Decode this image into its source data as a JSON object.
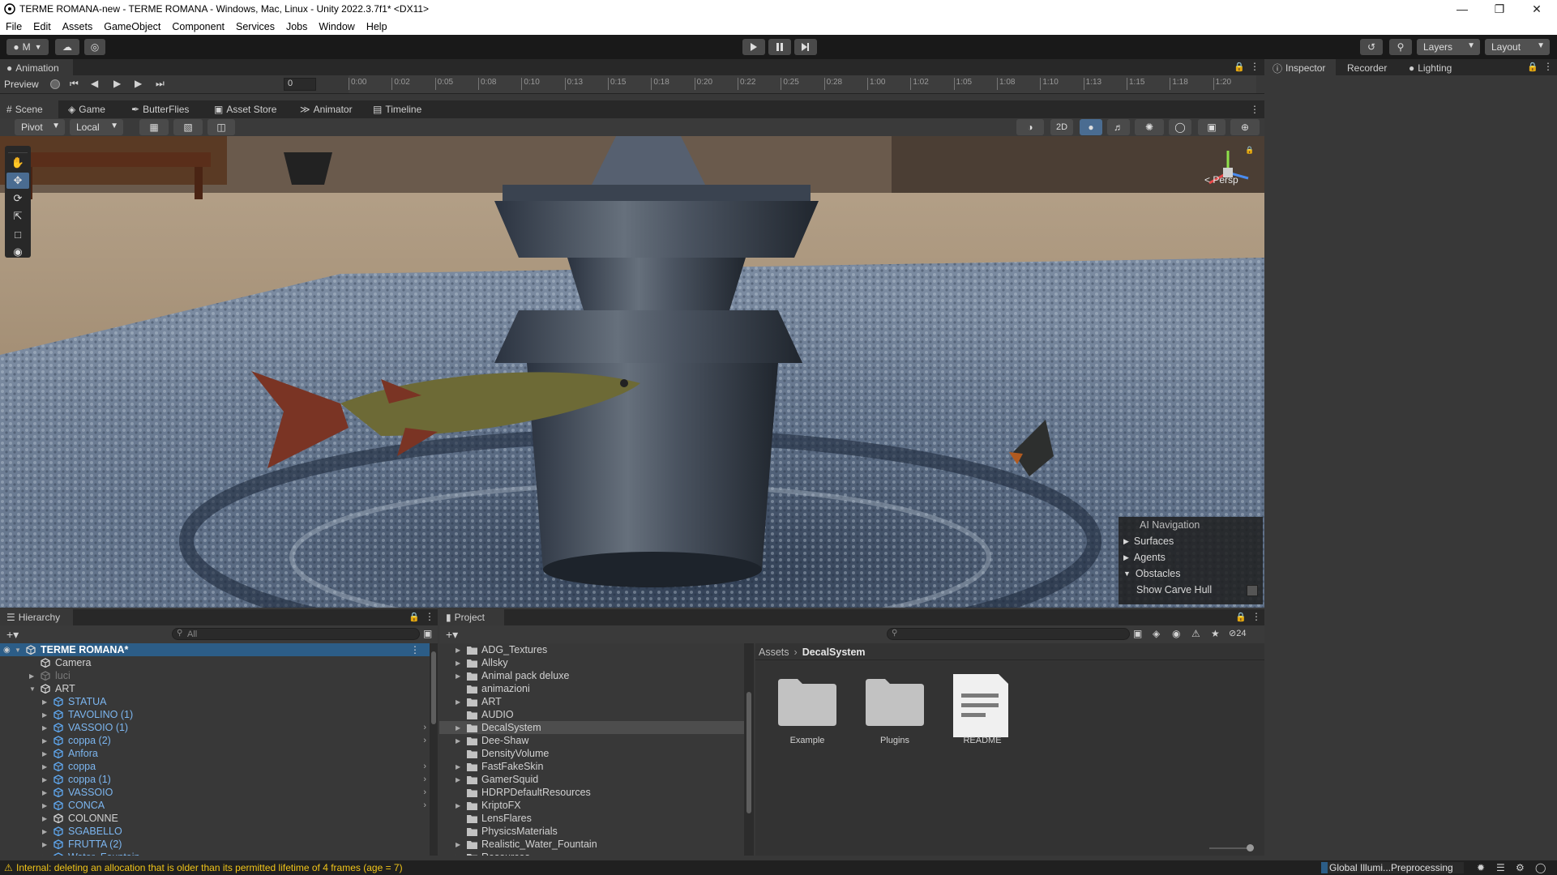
{
  "window": {
    "title": "TERME ROMANA-new - TERME ROMANA - Windows, Mac, Linux - Unity 2022.3.7f1* <DX11>"
  },
  "menu": [
    "File",
    "Edit",
    "Assets",
    "GameObject",
    "Component",
    "Services",
    "Jobs",
    "Window",
    "Help"
  ],
  "toolbar": {
    "account_label": "M",
    "layers_label": "Layers",
    "layout_label": "Layout"
  },
  "animation": {
    "tab_label": "Animation",
    "preview_label": "Preview",
    "frame_value": "0",
    "timeline_ticks": [
      "0:00",
      "0:02",
      "0:05",
      "0:08",
      "0:10",
      "0:13",
      "0:15",
      "0:18",
      "0:20",
      "0:22",
      "0:25",
      "0:28",
      "1:00",
      "1:02",
      "1:05",
      "1:08",
      "1:10",
      "1:13",
      "1:15",
      "1:18",
      "1:20"
    ]
  },
  "scene_tabs": [
    "Scene",
    "Game",
    "ButterFlies",
    "Asset Store",
    "Animator",
    "Timeline"
  ],
  "scene_toolbar": {
    "pivot_label": "Pivot",
    "local_label": "Local",
    "mode_2d_label": "2D"
  },
  "scene": {
    "persp_label": "Persp",
    "ai_nav": {
      "title": "AI Navigation",
      "items": [
        "Surfaces",
        "Agents",
        "Obstacles"
      ],
      "show_carve_hull_label": "Show Carve Hull"
    }
  },
  "inspector_tabs": [
    "Inspector",
    "Recorder",
    "Lighting"
  ],
  "hierarchy": {
    "tab_label": "Hierarchy",
    "search_placeholder": "All",
    "items": [
      {
        "label": "TERME ROMANA*",
        "kind": "scene",
        "depth": 0
      },
      {
        "label": "Camera",
        "kind": "object",
        "depth": 1
      },
      {
        "label": "luci",
        "kind": "disabled",
        "depth": 1
      },
      {
        "label": "ART",
        "kind": "object",
        "depth": 1
      },
      {
        "label": "STATUA",
        "kind": "prefab",
        "depth": 2
      },
      {
        "label": "TAVOLINO (1)",
        "kind": "prefab",
        "depth": 2
      },
      {
        "label": "VASSOIO (1)",
        "kind": "prefab",
        "depth": 2
      },
      {
        "label": "coppa (2)",
        "kind": "prefab",
        "depth": 2
      },
      {
        "label": "Anfora",
        "kind": "prefab",
        "depth": 2
      },
      {
        "label": "coppa",
        "kind": "prefab",
        "depth": 2
      },
      {
        "label": "coppa (1)",
        "kind": "prefab",
        "depth": 2
      },
      {
        "label": "VASSOIO",
        "kind": "prefab",
        "depth": 2
      },
      {
        "label": "CONCA",
        "kind": "prefab",
        "depth": 2
      },
      {
        "label": "COLONNE",
        "kind": "object",
        "depth": 2
      },
      {
        "label": "SGABELLO",
        "kind": "prefab",
        "depth": 2
      },
      {
        "label": "FRUTTA (2)",
        "kind": "prefab",
        "depth": 2
      },
      {
        "label": "Water_Fountain",
        "kind": "prefab",
        "depth": 2
      }
    ]
  },
  "project": {
    "tab_label": "Project",
    "hidden_count": "24",
    "breadcrumb": [
      "Assets",
      "DecalSystem"
    ],
    "folders": [
      "ADG_Textures",
      "Allsky",
      "Animal pack deluxe",
      "animazioni",
      "ART",
      "AUDIO",
      "DecalSystem",
      "Dee-Shaw",
      "DensityVolume",
      "FastFakeSkin",
      "GamerSquid",
      "HDRPDefaultResources",
      "KriptoFX",
      "LensFlares",
      "PhysicsMaterials",
      "Realistic_Water_Fountain",
      "Resources"
    ],
    "assets": [
      {
        "label": "Example",
        "type": "folder"
      },
      {
        "label": "Plugins",
        "type": "folder"
      },
      {
        "label": "README",
        "type": "document"
      }
    ]
  },
  "status": {
    "warning_message": "Internal: deleting an allocation that is older than its permitted lifetime of 4 frames (age = 7)",
    "progress_label": "Global Illumi...Preprocessing"
  },
  "colors": {
    "selection": "#2c5d87",
    "prefab_text": "#7cb6f0",
    "warning_text": "#f0c419"
  }
}
